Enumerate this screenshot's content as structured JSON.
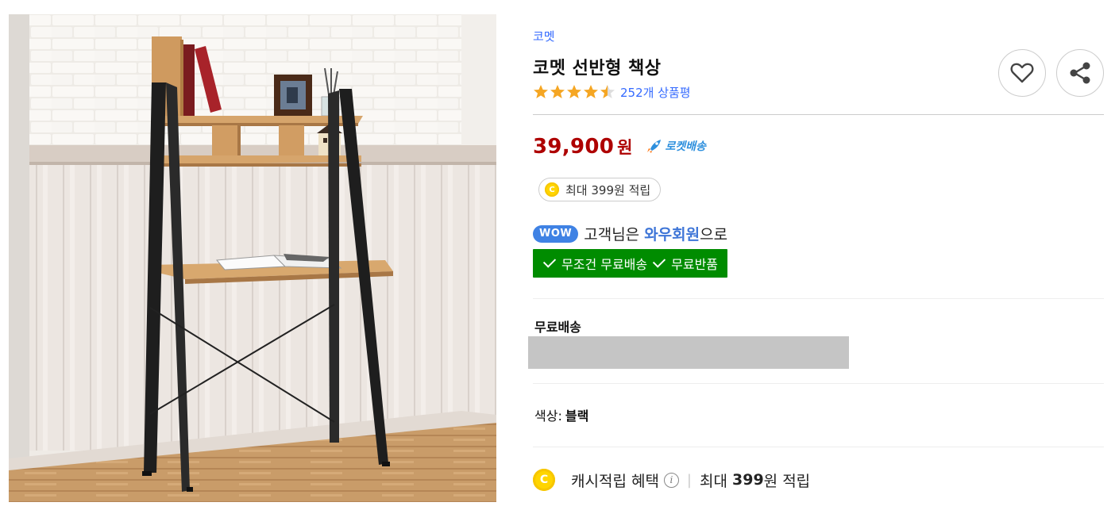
{
  "product": {
    "brand": "코멧",
    "title": "코멧 선반형 책상",
    "rating": 4.5,
    "review_count": "252개 상품평"
  },
  "icons": {
    "wishlist": "heart-icon",
    "share": "share-icon",
    "rocket": "rocket-icon",
    "coin": "cash-coin-icon",
    "info": "info-icon",
    "check": "check-icon"
  },
  "price": {
    "amount": "39,900",
    "unit": "원",
    "delivery_badge": "로켓배송"
  },
  "cash_pill": {
    "coin_letter": "C",
    "text": "최대 399원 적립"
  },
  "wow": {
    "badge": "WOW",
    "text_before": "고객님은 ",
    "text_strong": "와우회원",
    "text_after": "으로",
    "benefit_1": "무조건 무료배송",
    "benefit_2": "무료반품"
  },
  "shipping": {
    "label": "무료배송"
  },
  "option": {
    "label": "색상:",
    "value": "블랙"
  },
  "cash_benefit": {
    "coin_letter": "C",
    "label": "캐시적립 혜택",
    "info_glyph": "i",
    "separator": "|",
    "prefix": "최대 ",
    "amount": "399",
    "suffix": "원 적립"
  },
  "colors": {
    "link_blue": "#346aff",
    "price_red": "#ae0000",
    "rocket_blue": "#2d8fdd",
    "wow_blue": "#3f82e4",
    "wow_green": "#008c00",
    "star_orange": "#f5a623",
    "coin_yellow": "#ffd500"
  }
}
